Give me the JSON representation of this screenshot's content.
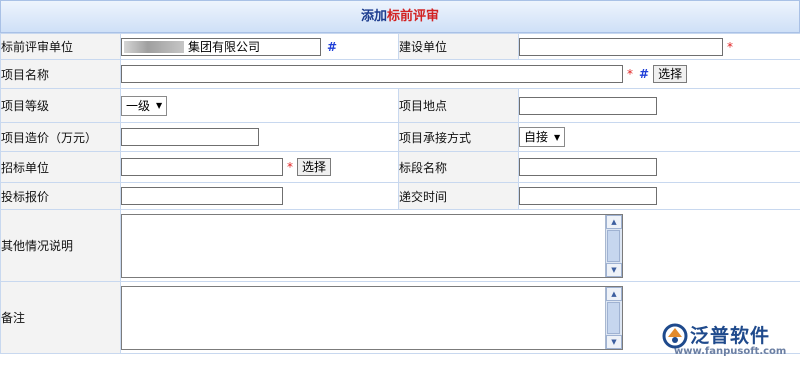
{
  "header": {
    "title_prefix": "添加",
    "title_highlight": "标前评审"
  },
  "fields": {
    "unit_label": "标前评审单位",
    "unit_value": "集团有限公司",
    "hash_mark": "#",
    "construction_unit_label": "建设单位",
    "project_name_label": "项目名称",
    "grade_label": "项目等级",
    "grade_value": "一级",
    "location_label": "项目地点",
    "cost_label": "项目造价（万元）",
    "contract_mode_label": "项目承接方式",
    "contract_mode_value": "自接",
    "tender_unit_label": "招标单位",
    "section_name_label": "标段名称",
    "bid_price_label": "投标报价",
    "submit_time_label": "递交时间",
    "other_info_label": "其他情况说明",
    "remarks_label": "备注",
    "required_mark": "*",
    "select_button_label": "选择"
  },
  "scrollbar": {
    "up_glyph": "▲",
    "down_glyph": "▼"
  },
  "dropdown_arrow": "▼",
  "watermark": {
    "brand": "泛普软件",
    "url": "www.fanpusoft.com"
  },
  "colors": {
    "header_blue": "#1d3d8f",
    "header_red": "#d22222",
    "required_red": "#e02020",
    "hash_blue": "#1f3fd8",
    "label_bg": "#f3f3f3"
  }
}
